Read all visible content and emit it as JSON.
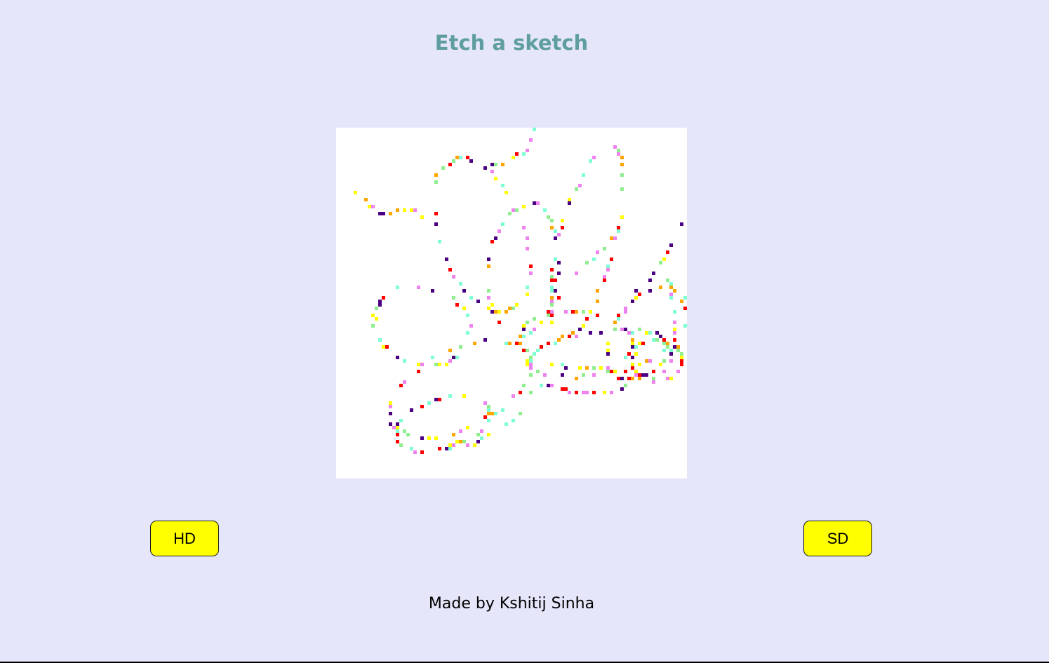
{
  "page": {
    "title": "Etch a sketch",
    "footer": "Made by Kshitij Sinha"
  },
  "controls": {
    "hd_label": "HD",
    "sd_label": "SD"
  },
  "colors": {
    "background": "#e6e6fa",
    "title": "#5f9ea0",
    "button": "#ffff00",
    "board": "#ffffff",
    "palette": [
      "#ff0000",
      "#ffa500",
      "#ffff00",
      "#90ee90",
      "#7fffd4",
      "#ee82ee",
      "#4b0082"
    ]
  },
  "icons": {
    "drawing": "etch-sketch-doodle"
  }
}
